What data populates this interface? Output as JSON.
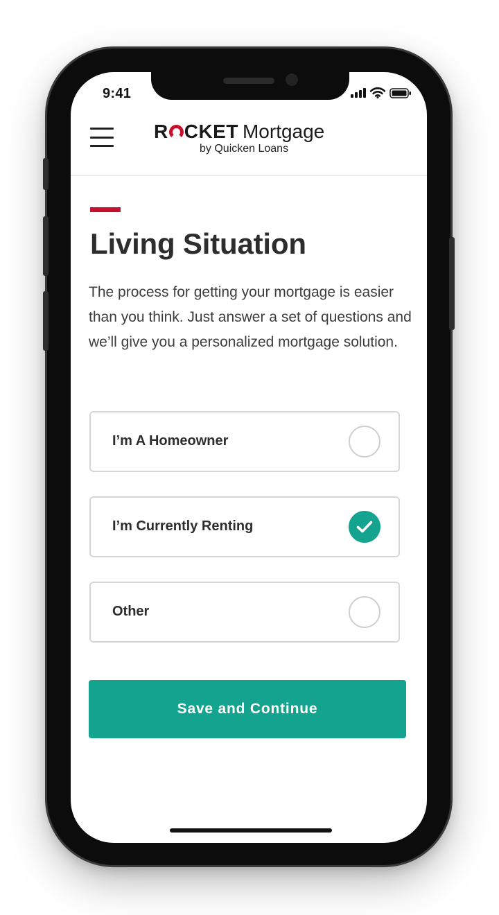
{
  "status_bar": {
    "time": "9:41"
  },
  "header": {
    "logo_rocket_start": "R",
    "logo_rocket_end": "CKET",
    "logo_product": "Mortgage",
    "logo_subtitle": "by Quicken Loans"
  },
  "content": {
    "title": "Living Situation",
    "intro": "The process for getting your mortgage is easier than you think. Just answer a set of questions and we’ll give you a personalized mortgage solution.",
    "options": [
      {
        "label": "I’m A Homeowner",
        "selected": false
      },
      {
        "label": "I’m Currently Renting",
        "selected": true
      },
      {
        "label": "Other",
        "selected": false
      }
    ],
    "submit_label": "Save and Continue"
  },
  "colors": {
    "brand_red": "#c8102e",
    "accent_teal": "#14a38e",
    "text_dark": "#2d2d2d",
    "border_gray": "#d6d6d6"
  }
}
